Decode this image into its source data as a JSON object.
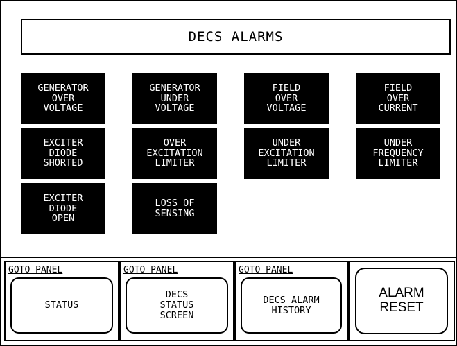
{
  "header": {
    "title": "DECS ALARMS"
  },
  "alarms": [
    {
      "label": "GENERATOR\nOVER\nVOLTAGE"
    },
    {
      "label": "GENERATOR\nUNDER\nVOLTAGE"
    },
    {
      "label": "FIELD\nOVER\nVOLTAGE"
    },
    {
      "label": "FIELD\nOVER\nCURRENT"
    },
    {
      "label": "EXCITER\nDIODE\nSHORTED"
    },
    {
      "label": "OVER\nEXCITATION\nLIMITER"
    },
    {
      "label": "UNDER\nEXCITATION\nLIMITER"
    },
    {
      "label": "UNDER\nFREQUENCY\nLIMITER"
    },
    {
      "label": "EXCITER\nDIODE\nOPEN"
    },
    {
      "label": "LOSS OF\nSENSING"
    }
  ],
  "nav": [
    {
      "header": "GOTO PANEL",
      "label": "STATUS"
    },
    {
      "header": "GOTO PANEL",
      "label": "DECS\nSTATUS\nSCREEN"
    },
    {
      "header": "GOTO PANEL",
      "label": "DECS ALARM\nHISTORY"
    }
  ],
  "reset": {
    "label": "ALARM\nRESET"
  },
  "colors": {
    "alarm_bg": "#000000",
    "alarm_text": "#ffffff",
    "background": "#ffffff"
  }
}
